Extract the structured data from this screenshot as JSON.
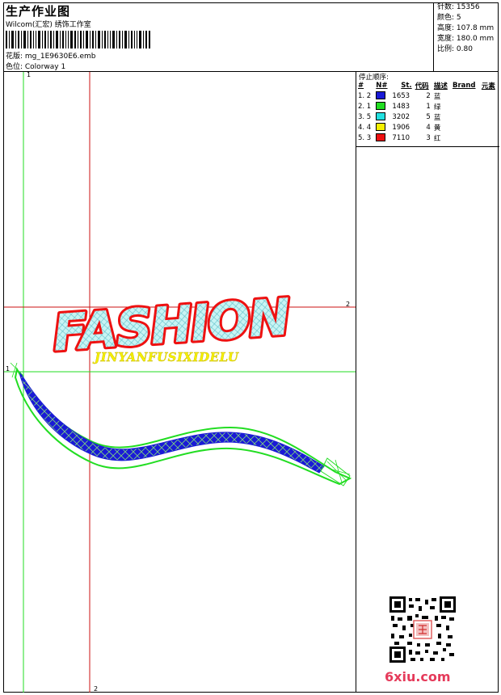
{
  "header": {
    "title": "生产作业图",
    "company": "Wilcom(汇宏) 绣饰工作室",
    "design_file": "花版: mg_1E9630E6.emb",
    "colorway": "色位: Colorway 1"
  },
  "stats": [
    {
      "label": "针数:",
      "value": "15356"
    },
    {
      "label": "颜色:",
      "value": "5"
    },
    {
      "label": "高度:",
      "value": "107.8 mm"
    },
    {
      "label": "宽度:",
      "value": "180.0 mm"
    },
    {
      "label": "比例:",
      "value": "0.80"
    }
  ],
  "stop_sequence": {
    "title": "停止顺序:",
    "headers": [
      "#",
      "N#",
      "St.",
      "代码",
      "描述",
      "Brand",
      "元素"
    ],
    "rows": [
      {
        "seq": "1. 2",
        "color": "#1a1ad6",
        "stitches": "1653",
        "code": "2",
        "desc": "蓝"
      },
      {
        "seq": "2. 1",
        "color": "#22dd22",
        "stitches": "1483",
        "code": "1",
        "desc": "绿"
      },
      {
        "seq": "3. 5",
        "color": "#22e0e0",
        "stitches": "3202",
        "code": "5",
        "desc": "蓝"
      },
      {
        "seq": "4. 4",
        "color": "#f5f000",
        "stitches": "1906",
        "code": "4",
        "desc": "黄"
      },
      {
        "seq": "5. 3",
        "color": "#ee1111",
        "stitches": "7110",
        "code": "3",
        "desc": "红"
      }
    ]
  },
  "design": {
    "main_text": "FASHION",
    "sub_text": "JINYANFUSIXIDELU"
  },
  "guides": {
    "vertical_green_label": "1",
    "horizontal_green_label": "1",
    "horizontal_red_label": "2",
    "vertical_red_label": "2"
  },
  "watermark": "6xiu.com",
  "colors": {
    "red": "#ee1111",
    "green": "#22dd22",
    "blue": "#1a1ad6",
    "cyan": "#c8f4f4",
    "yellow": "#f5f000",
    "brand_pink": "#e53a5a"
  }
}
